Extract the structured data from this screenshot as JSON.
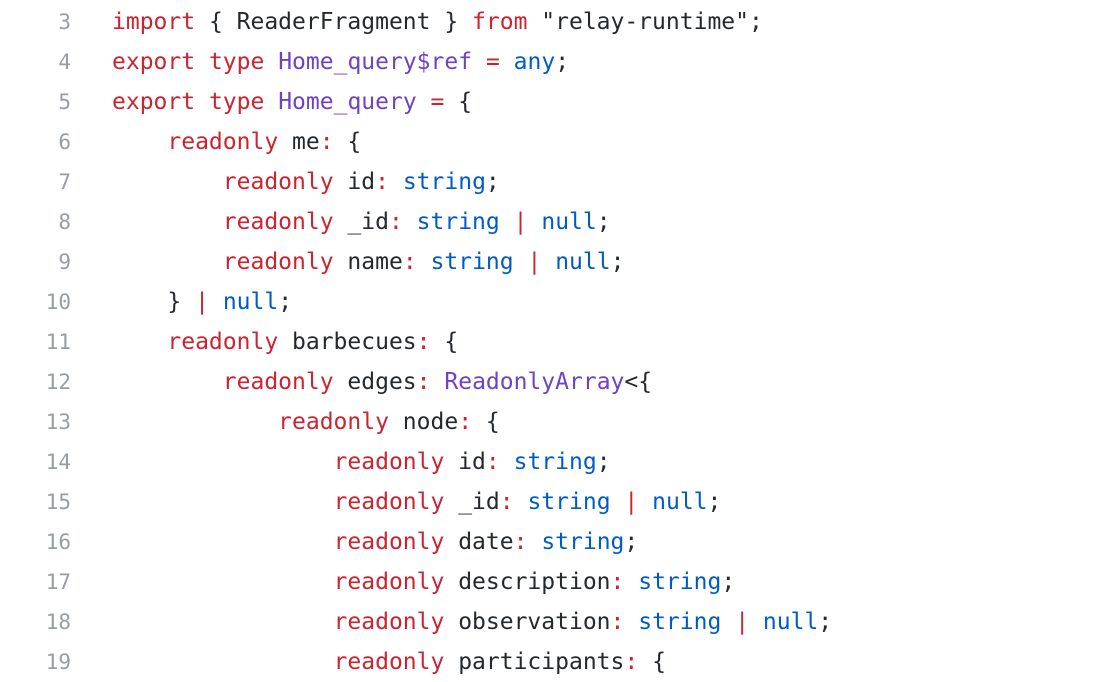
{
  "editor": {
    "lines": [
      {
        "number": "3",
        "tokens": [
          {
            "text": "import",
            "kind": "keyword"
          },
          {
            "text": " { ReaderFragment } ",
            "kind": "plain"
          },
          {
            "text": "from",
            "kind": "keyword"
          },
          {
            "text": " \"relay-runtime\";",
            "kind": "plain"
          }
        ]
      },
      {
        "number": "4",
        "tokens": [
          {
            "text": "export",
            "kind": "keyword"
          },
          {
            "text": " ",
            "kind": "plain"
          },
          {
            "text": "type",
            "kind": "keyword"
          },
          {
            "text": " ",
            "kind": "plain"
          },
          {
            "text": "Home_query$ref",
            "kind": "type"
          },
          {
            "text": " ",
            "kind": "plain"
          },
          {
            "text": "=",
            "kind": "operator"
          },
          {
            "text": " ",
            "kind": "plain"
          },
          {
            "text": "any",
            "kind": "builtin"
          },
          {
            "text": ";",
            "kind": "plain"
          }
        ]
      },
      {
        "number": "5",
        "tokens": [
          {
            "text": "export",
            "kind": "keyword"
          },
          {
            "text": " ",
            "kind": "plain"
          },
          {
            "text": "type",
            "kind": "keyword"
          },
          {
            "text": " ",
            "kind": "plain"
          },
          {
            "text": "Home_query",
            "kind": "type"
          },
          {
            "text": " ",
            "kind": "plain"
          },
          {
            "text": "=",
            "kind": "operator"
          },
          {
            "text": " {",
            "kind": "plain"
          }
        ]
      },
      {
        "number": "6",
        "tokens": [
          {
            "text": "    ",
            "kind": "plain"
          },
          {
            "text": "readonly",
            "kind": "keyword"
          },
          {
            "text": " me",
            "kind": "plain"
          },
          {
            "text": ":",
            "kind": "operator"
          },
          {
            "text": " {",
            "kind": "plain"
          }
        ]
      },
      {
        "number": "7",
        "tokens": [
          {
            "text": "        ",
            "kind": "plain"
          },
          {
            "text": "readonly",
            "kind": "keyword"
          },
          {
            "text": " id",
            "kind": "plain"
          },
          {
            "text": ":",
            "kind": "operator"
          },
          {
            "text": " ",
            "kind": "plain"
          },
          {
            "text": "string",
            "kind": "builtin"
          },
          {
            "text": ";",
            "kind": "plain"
          }
        ]
      },
      {
        "number": "8",
        "tokens": [
          {
            "text": "        ",
            "kind": "plain"
          },
          {
            "text": "readonly",
            "kind": "keyword"
          },
          {
            "text": " _id",
            "kind": "plain"
          },
          {
            "text": ":",
            "kind": "operator"
          },
          {
            "text": " ",
            "kind": "plain"
          },
          {
            "text": "string",
            "kind": "builtin"
          },
          {
            "text": " ",
            "kind": "plain"
          },
          {
            "text": "|",
            "kind": "operator"
          },
          {
            "text": " ",
            "kind": "plain"
          },
          {
            "text": "null",
            "kind": "builtin"
          },
          {
            "text": ";",
            "kind": "plain"
          }
        ]
      },
      {
        "number": "9",
        "tokens": [
          {
            "text": "        ",
            "kind": "plain"
          },
          {
            "text": "readonly",
            "kind": "keyword"
          },
          {
            "text": " name",
            "kind": "plain"
          },
          {
            "text": ":",
            "kind": "operator"
          },
          {
            "text": " ",
            "kind": "plain"
          },
          {
            "text": "string",
            "kind": "builtin"
          },
          {
            "text": " ",
            "kind": "plain"
          },
          {
            "text": "|",
            "kind": "operator"
          },
          {
            "text": " ",
            "kind": "plain"
          },
          {
            "text": "null",
            "kind": "builtin"
          },
          {
            "text": ";",
            "kind": "plain"
          }
        ]
      },
      {
        "number": "10",
        "tokens": [
          {
            "text": "    } ",
            "kind": "plain"
          },
          {
            "text": "|",
            "kind": "operator"
          },
          {
            "text": " ",
            "kind": "plain"
          },
          {
            "text": "null",
            "kind": "builtin"
          },
          {
            "text": ";",
            "kind": "plain"
          }
        ]
      },
      {
        "number": "11",
        "tokens": [
          {
            "text": "    ",
            "kind": "plain"
          },
          {
            "text": "readonly",
            "kind": "keyword"
          },
          {
            "text": " barbecues",
            "kind": "plain"
          },
          {
            "text": ":",
            "kind": "operator"
          },
          {
            "text": " {",
            "kind": "plain"
          }
        ]
      },
      {
        "number": "12",
        "tokens": [
          {
            "text": "        ",
            "kind": "plain"
          },
          {
            "text": "readonly",
            "kind": "keyword"
          },
          {
            "text": " edges",
            "kind": "plain"
          },
          {
            "text": ":",
            "kind": "operator"
          },
          {
            "text": " ",
            "kind": "plain"
          },
          {
            "text": "ReadonlyArray",
            "kind": "type"
          },
          {
            "text": "<{",
            "kind": "plain"
          }
        ]
      },
      {
        "number": "13",
        "tokens": [
          {
            "text": "            ",
            "kind": "plain"
          },
          {
            "text": "readonly",
            "kind": "keyword"
          },
          {
            "text": " node",
            "kind": "plain"
          },
          {
            "text": ":",
            "kind": "operator"
          },
          {
            "text": " {",
            "kind": "plain"
          }
        ]
      },
      {
        "number": "14",
        "tokens": [
          {
            "text": "                ",
            "kind": "plain"
          },
          {
            "text": "readonly",
            "kind": "keyword"
          },
          {
            "text": " id",
            "kind": "plain"
          },
          {
            "text": ":",
            "kind": "operator"
          },
          {
            "text": " ",
            "kind": "plain"
          },
          {
            "text": "string",
            "kind": "builtin"
          },
          {
            "text": ";",
            "kind": "plain"
          }
        ]
      },
      {
        "number": "15",
        "tokens": [
          {
            "text": "                ",
            "kind": "plain"
          },
          {
            "text": "readonly",
            "kind": "keyword"
          },
          {
            "text": " _id",
            "kind": "plain"
          },
          {
            "text": ":",
            "kind": "operator"
          },
          {
            "text": " ",
            "kind": "plain"
          },
          {
            "text": "string",
            "kind": "builtin"
          },
          {
            "text": " ",
            "kind": "plain"
          },
          {
            "text": "|",
            "kind": "operator"
          },
          {
            "text": " ",
            "kind": "plain"
          },
          {
            "text": "null",
            "kind": "builtin"
          },
          {
            "text": ";",
            "kind": "plain"
          }
        ]
      },
      {
        "number": "16",
        "tokens": [
          {
            "text": "                ",
            "kind": "plain"
          },
          {
            "text": "readonly",
            "kind": "keyword"
          },
          {
            "text": " date",
            "kind": "plain"
          },
          {
            "text": ":",
            "kind": "operator"
          },
          {
            "text": " ",
            "kind": "plain"
          },
          {
            "text": "string",
            "kind": "builtin"
          },
          {
            "text": ";",
            "kind": "plain"
          }
        ]
      },
      {
        "number": "17",
        "tokens": [
          {
            "text": "                ",
            "kind": "plain"
          },
          {
            "text": "readonly",
            "kind": "keyword"
          },
          {
            "text": " description",
            "kind": "plain"
          },
          {
            "text": ":",
            "kind": "operator"
          },
          {
            "text": " ",
            "kind": "plain"
          },
          {
            "text": "string",
            "kind": "builtin"
          },
          {
            "text": ";",
            "kind": "plain"
          }
        ]
      },
      {
        "number": "18",
        "tokens": [
          {
            "text": "                ",
            "kind": "plain"
          },
          {
            "text": "readonly",
            "kind": "keyword"
          },
          {
            "text": " observation",
            "kind": "plain"
          },
          {
            "text": ":",
            "kind": "operator"
          },
          {
            "text": " ",
            "kind": "plain"
          },
          {
            "text": "string",
            "kind": "builtin"
          },
          {
            "text": " ",
            "kind": "plain"
          },
          {
            "text": "|",
            "kind": "operator"
          },
          {
            "text": " ",
            "kind": "plain"
          },
          {
            "text": "null",
            "kind": "builtin"
          },
          {
            "text": ";",
            "kind": "plain"
          }
        ]
      },
      {
        "number": "19",
        "tokens": [
          {
            "text": "                ",
            "kind": "plain"
          },
          {
            "text": "readonly",
            "kind": "keyword"
          },
          {
            "text": " participants",
            "kind": "plain"
          },
          {
            "text": ":",
            "kind": "operator"
          },
          {
            "text": " {",
            "kind": "plain"
          }
        ]
      }
    ]
  }
}
